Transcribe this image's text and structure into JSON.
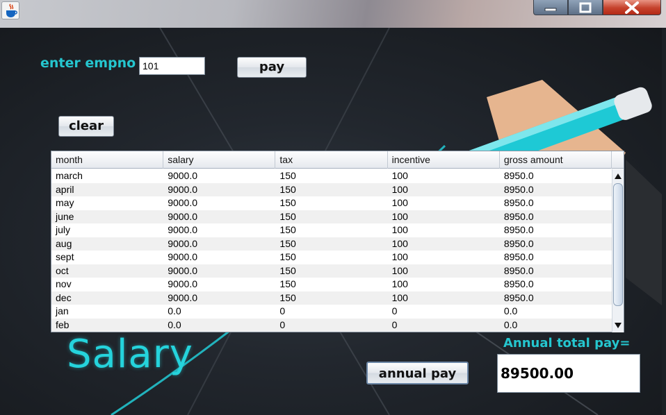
{
  "form": {
    "empno_label": "enter empno",
    "empno_value": "101",
    "pay_button": "pay",
    "clear_button": "clear",
    "annual_pay_button": "annual pay",
    "annual_total_label": "Annual total pay=",
    "annual_total_value": "89500.00"
  },
  "table": {
    "columns": [
      "month",
      "salary",
      "tax",
      "incentive",
      "gross amount"
    ],
    "rows": [
      [
        "march",
        "9000.0",
        "150",
        "100",
        "8950.0"
      ],
      [
        "april",
        "9000.0",
        "150",
        "100",
        "8950.0"
      ],
      [
        "may",
        "9000.0",
        "150",
        "100",
        "8950.0"
      ],
      [
        "june",
        "9000.0",
        "150",
        "100",
        "8950.0"
      ],
      [
        "july",
        "9000.0",
        "150",
        "100",
        "8950.0"
      ],
      [
        "aug",
        "9000.0",
        "150",
        "100",
        "8950.0"
      ],
      [
        "sept",
        "9000.0",
        "150",
        "100",
        "8950.0"
      ],
      [
        "oct",
        "9000.0",
        "150",
        "100",
        "8950.0"
      ],
      [
        "nov",
        "9000.0",
        "150",
        "100",
        "8950.0"
      ],
      [
        "dec",
        "9000.0",
        "150",
        "100",
        "8950.0"
      ],
      [
        "jan",
        "0.0",
        "0",
        "0",
        "0.0"
      ],
      [
        "feb",
        "0.0",
        "0",
        "0",
        "0.0"
      ]
    ]
  },
  "background": {
    "logo_text": "Salary",
    "accent_color": "#25c6cf"
  },
  "icons": {
    "app": "java-cup-icon",
    "minimize": "minimize-icon",
    "maximize": "maximize-icon",
    "close": "close-icon"
  }
}
